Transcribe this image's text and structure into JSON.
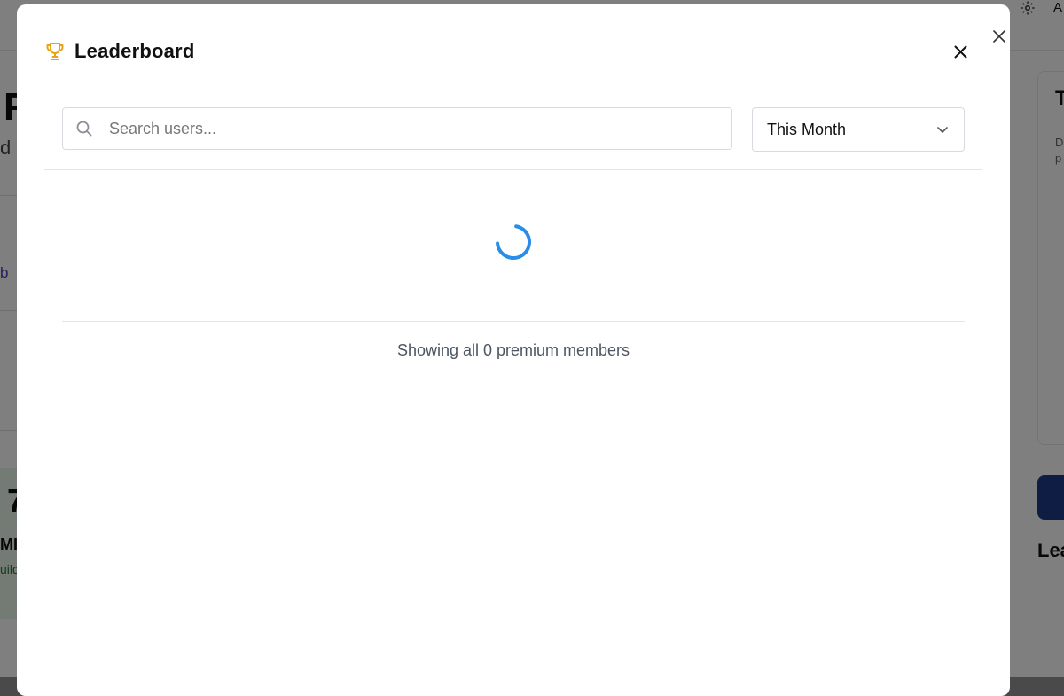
{
  "background": {
    "top_right_letter": "A",
    "left_snippets": [
      "F",
      "d",
      "b",
      "7",
      "MIU",
      "uild"
    ],
    "right_snippets": [
      "T",
      "D\np",
      "Lea"
    ]
  },
  "modal": {
    "title": "Leaderboard",
    "search": {
      "placeholder": "Search users...",
      "value": ""
    },
    "period": {
      "selected": "This Month"
    },
    "status_text": "Showing all 0 premium members"
  },
  "icons": {
    "trophy": "trophy-icon",
    "search": "search-icon",
    "chevron": "chevron-down-icon",
    "close": "close-icon",
    "spinner": "loading-spinner",
    "gear": "gear-icon"
  },
  "colors": {
    "trophy": "#e8a317",
    "spinner": "#2a8ee8",
    "overlay": "rgba(0,0,0,0.5)"
  }
}
